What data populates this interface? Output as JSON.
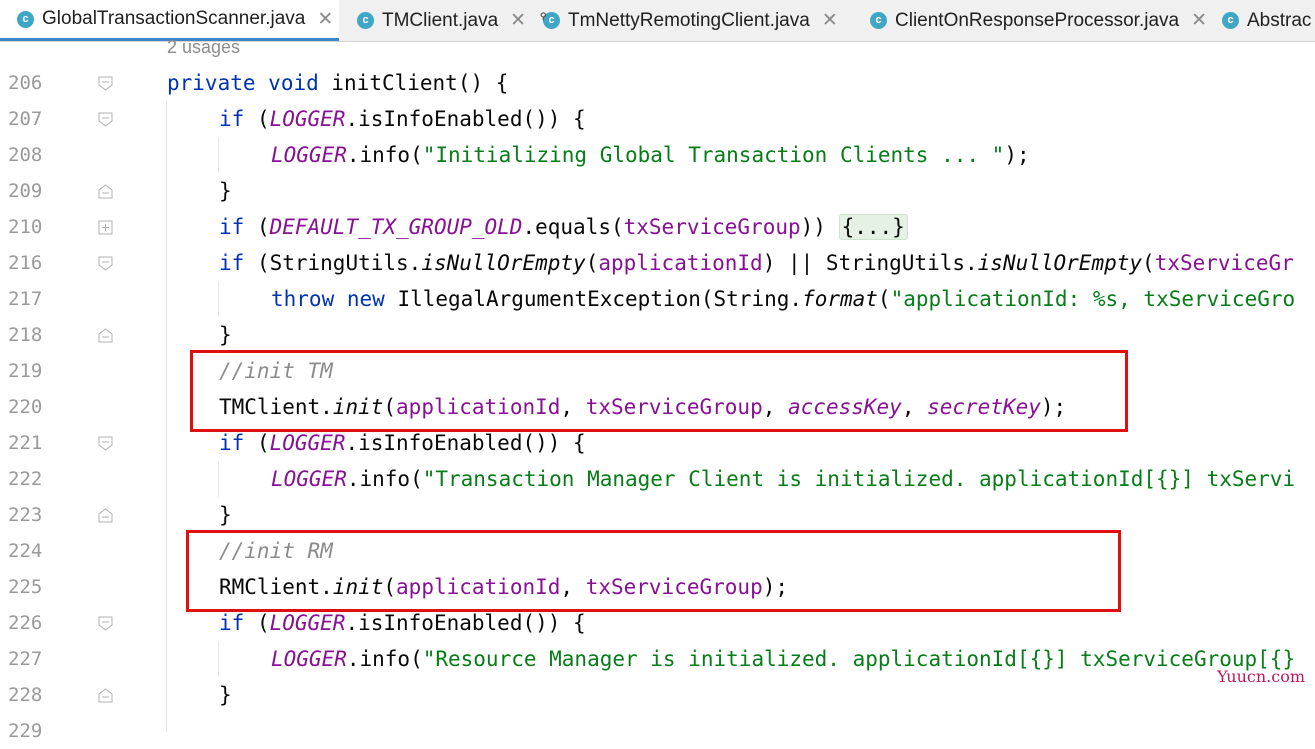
{
  "tabs": [
    {
      "label": "GlobalTransactionScanner.java",
      "active": true,
      "close": "✕"
    },
    {
      "label": "TMClient.java",
      "active": false,
      "close": "✕"
    },
    {
      "label": "TmNettyRemotingClient.java",
      "active": false,
      "close": "✕"
    },
    {
      "label": "ClientOnResponseProcessor.java",
      "active": false,
      "close": "✕"
    },
    {
      "label": "Abstrac",
      "active": false,
      "close": ""
    }
  ],
  "editor": {
    "usages": "2 usages",
    "line_numbers": [
      "206",
      "207",
      "208",
      "209",
      "210",
      "216",
      "217",
      "218",
      "219",
      "220",
      "221",
      "222",
      "223",
      "224",
      "225",
      "226",
      "227",
      "228",
      "229"
    ],
    "code": {
      "l206": {
        "kw1": "private",
        "kw2": "void",
        "rest": " initClient() {"
      },
      "l207": {
        "kw": "if",
        "p1": " (",
        "logger": "LOGGER",
        "rest": ".isInfoEnabled()) {"
      },
      "l208": {
        "logger": "LOGGER",
        "m": ".info(",
        "str": "\"Initializing Global Transaction Clients ... \"",
        "end": ");"
      },
      "l209": "}",
      "l210": {
        "kw": "if",
        "p1": " (",
        "const": "DEFAULT_TX_GROUP_OLD",
        "m": ".equals(",
        "field": "txServiceGroup",
        "p2": ")) ",
        "folded": "{...}"
      },
      "l216": {
        "kw": "if",
        "p1": " (StringUtils.",
        "m1": "isNullOrEmpty",
        "p2": "(",
        "f1": "applicationId",
        "p3": ") || StringUtils.",
        "m2": "isNullOrEmpty",
        "p4": "(",
        "f2": "txServiceGr"
      },
      "l217": {
        "kw1": "throw",
        "kw2": "new",
        "p1": " IllegalArgumentException(String.",
        "m": "format",
        "p2": "(",
        "str": "\"applicationId: %s, txServiceGro"
      },
      "l218": "}",
      "l219": "//init TM",
      "l220": {
        "cls": "TMClient.",
        "m": "init",
        "p1": "(",
        "f1": "applicationId",
        "c1": ", ",
        "f2": "txServiceGroup",
        "c2": ", ",
        "f3": "accessKey",
        "c3": ", ",
        "f4": "secretKey",
        "end": ");"
      },
      "l221": {
        "kw": "if",
        "p1": " (",
        "logger": "LOGGER",
        "rest": ".isInfoEnabled()) {"
      },
      "l222": {
        "logger": "LOGGER",
        "m": ".info(",
        "str": "\"Transaction Manager Client is initialized. applicationId[{}] txServi"
      },
      "l223": "}",
      "l224": "//init RM",
      "l225": {
        "cls": "RMClient.",
        "m": "init",
        "p1": "(",
        "f1": "applicationId",
        "c1": ", ",
        "f2": "txServiceGroup",
        "end": ");"
      },
      "l226": {
        "kw": "if",
        "p1": " (",
        "logger": "LOGGER",
        "rest": ".isInfoEnabled()) {"
      },
      "l227": {
        "logger": "LOGGER",
        "m": ".info(",
        "str": "\"Resource Manager is initialized. applicationId[{}] txServiceGroup[{}"
      },
      "l228": "}"
    }
  },
  "watermark": "Yuucn.com",
  "colors": {
    "keyword": "#0033b3",
    "string": "#067d17",
    "field": "#871094",
    "comment": "#8c8c8c",
    "highlight": "#e01010",
    "tab_accent": "#4083c9",
    "class_icon": "#3fa7c5"
  }
}
